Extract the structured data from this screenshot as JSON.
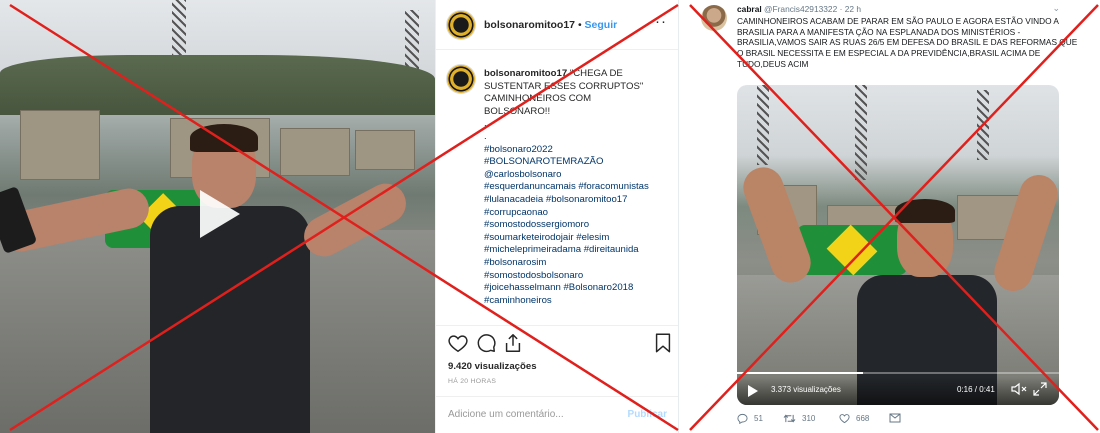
{
  "instagram": {
    "username": "bolsonaromitoo17",
    "separator": "•",
    "follow_label": "Seguir",
    "more_label": "···",
    "caption": {
      "author": "bolsonaromitoo17",
      "text_lines": [
        "\"CHEGA DE",
        "SUSTENTAR ESSES CORRUPTOS\"",
        "CAMINHONEIROS COM",
        "BOLSONARO!!",
        ".",
        "."
      ],
      "hashtags": [
        "#bolsonaro2022",
        "#BOLSONAROTEMRAZÃO",
        "@carlosbolsonaro",
        "#esquerdanuncamais #foracomunistas",
        "#lulanacadeia #bolsonaromitoo17",
        "#corrupcaonao",
        "#somostodossergiomoro",
        "#soumarketeirodojair #elesim",
        "#micheleprimeiradama #direitaunida",
        "#bolsonarosim",
        "#somostodosbolsonaro",
        "#joicehasselmann #Bolsonaro2018",
        "#caminhoneiros"
      ]
    },
    "icons": [
      "heart-icon",
      "comment-icon",
      "share-icon",
      "bookmark-icon",
      "play-icon"
    ],
    "views": "9.420 visualizações",
    "time": "HÁ 20 HORAS",
    "comment_placeholder": "Adicione um comentário...",
    "publish_label": "Publicar"
  },
  "twitter": {
    "name": "cabral",
    "handle": "@Francis42913322",
    "time": "· 22 h",
    "chevron": "⌄",
    "text": "CAMINHONEIROS ACABAM DE PARAR EM SÃO PAULO E AGORA  ESTÃO VINDO A BRASILIA PARA A MANIFESTA ÇÃO NA ESPLANADA DOS MINISTÉRIOS - BRASILIA,VAMOS SAIR AS RUAS 26/5 EM DEFESA DO BRASIL E DAS REFORMAS QUE O BRASIL NECESSITA E EM ESPECIAL A DA PREVIDÊNCIA,BRASIL ACIMA DE TUDO,DEUS ACIM",
    "video": {
      "views": "3.373 visualizações",
      "duration": "0:16 / 0:41",
      "progress": 0.39
    },
    "actions": {
      "reply_count": "51",
      "retweet_count": "310",
      "like_count": "668"
    }
  },
  "overlay": {
    "x_color": "#e0201c"
  }
}
